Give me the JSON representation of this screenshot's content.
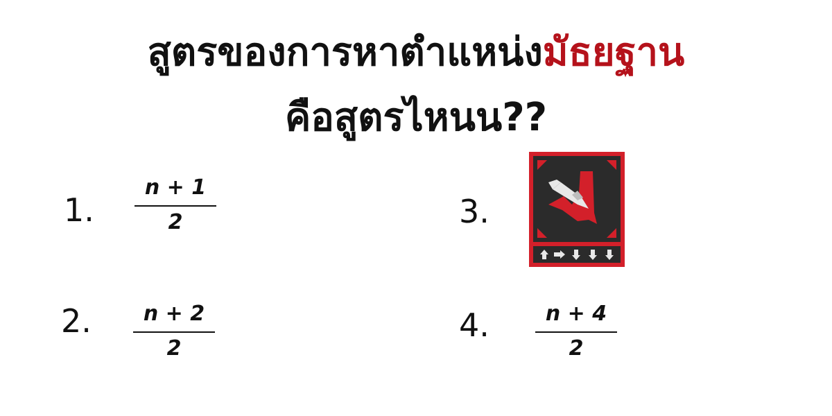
{
  "title": {
    "line1_prefix": "สูตรของการหาตำแหน่ง",
    "line1_accent": "มัธยฐาน",
    "line2": "คือสูตรไหนน??",
    "accent_color": "#b5121b"
  },
  "options": [
    {
      "number": "1.",
      "numerator": "n + 1",
      "denominator": "2"
    },
    {
      "number": "2.",
      "numerator": "n + 2",
      "denominator": "2"
    },
    {
      "number": "3.",
      "image_icon": "stratagem-icon",
      "arrow_sequence": [
        "up",
        "right",
        "down",
        "down",
        "down"
      ]
    },
    {
      "number": "4.",
      "numerator": "n + 4",
      "denominator": "2"
    }
  ],
  "colors": {
    "icon_red": "#d3202a",
    "icon_dark": "#2b2b2b",
    "icon_light": "#e8e8e8"
  }
}
